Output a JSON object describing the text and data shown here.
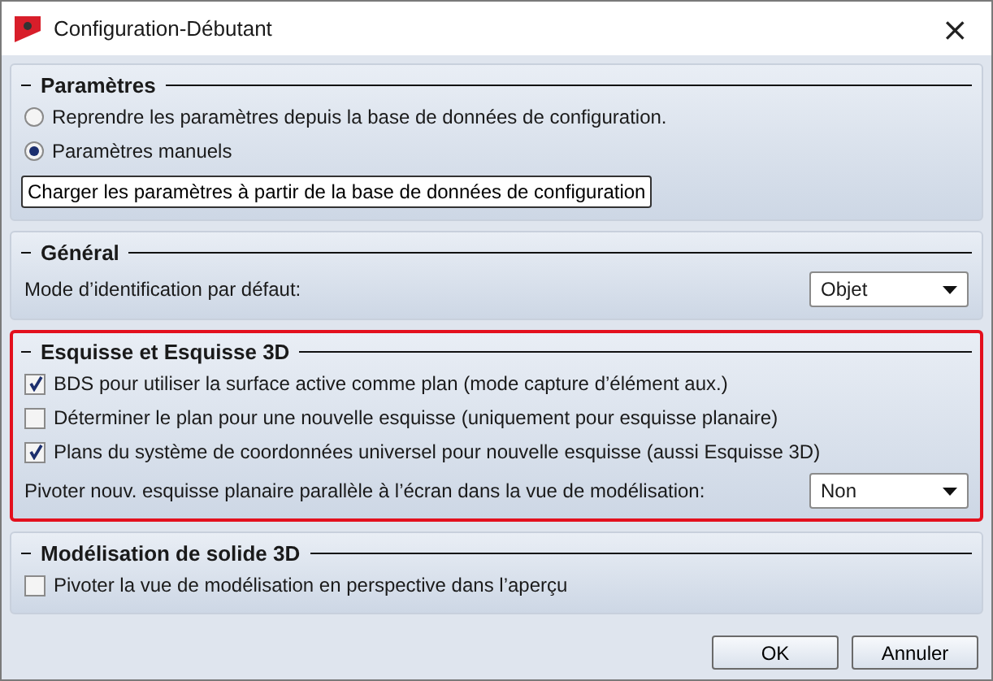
{
  "window": {
    "title": "Configuration-Débutant",
    "close": "×"
  },
  "sections": [
    {
      "title": "Paramètres",
      "highlighted": false,
      "items": [
        {
          "kind": "radio",
          "label": "Reprendre les paramètres depuis la base de données de configuration.",
          "selected": false
        },
        {
          "kind": "radio",
          "label": "Paramètres manuels",
          "selected": true
        },
        {
          "kind": "button",
          "label": "Charger les paramètres à partir de la base de données de configuration"
        }
      ]
    },
    {
      "title": "Général",
      "highlighted": false,
      "items": [
        {
          "kind": "select",
          "label": "Mode d’identification par défaut:",
          "value": "Objet"
        }
      ]
    },
    {
      "title": "Esquisse et Esquisse 3D",
      "highlighted": true,
      "items": [
        {
          "kind": "checkbox",
          "label": "BDS pour utiliser la surface active comme plan (mode capture d’élément aux.)",
          "checked": true
        },
        {
          "kind": "checkbox",
          "label": "Déterminer le plan pour une nouvelle esquisse (uniquement pour esquisse planaire)",
          "checked": false
        },
        {
          "kind": "checkbox",
          "label": "Plans du système de coordonnées universel pour nouvelle esquisse (aussi Esquisse 3D)",
          "checked": true
        },
        {
          "kind": "select",
          "label": "Pivoter nouv. esquisse planaire parallèle à l’écran dans la vue de modélisation:",
          "value": "Non"
        }
      ]
    },
    {
      "title": "Modélisation de solide 3D",
      "highlighted": false,
      "items": [
        {
          "kind": "checkbox",
          "label": "Pivoter la vue de modélisation en perspective dans l’aperçu",
          "checked": false
        }
      ]
    }
  ],
  "buttons": [
    "OK",
    "Annuler"
  ]
}
